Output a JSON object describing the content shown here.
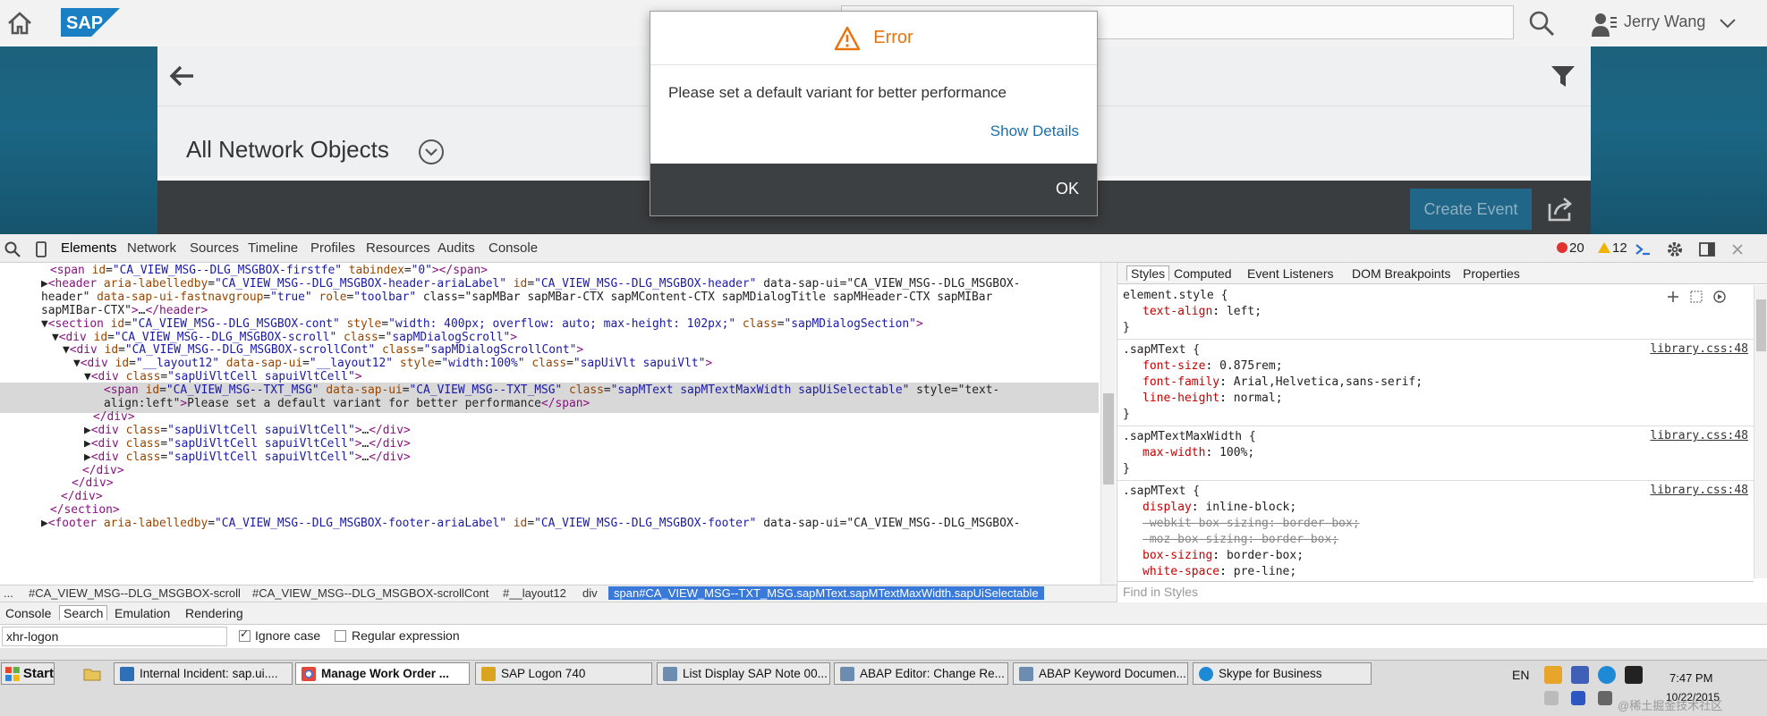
{
  "shell": {
    "user_name": "Jerry Wang"
  },
  "page": {
    "variant_title": "All Network Objects",
    "create_event_label": "Create Event"
  },
  "dialog": {
    "title": "Error",
    "message": "Please set a default variant for better performance",
    "show_details": "Show Details",
    "ok": "OK"
  },
  "devtools": {
    "tabs": [
      "Elements",
      "Network",
      "Sources",
      "Timeline",
      "Profiles",
      "Resources",
      "Audits",
      "Console"
    ],
    "error_count": "20",
    "warning_count": "12",
    "breadcrumbs": [
      "...",
      "#CA_VIEW_MSG--DLG_MSGBOX-scroll",
      "#CA_VIEW_MSG--DLG_MSGBOX-scrollCont",
      "#__layout12",
      "div",
      "span#CA_VIEW_MSG--TXT_MSG.sapMText.sapMTextMaxWidth.sapUiSelectable"
    ],
    "styles_tabs": [
      "Styles",
      "Computed",
      "Event Listeners",
      "DOM Breakpoints",
      "Properties"
    ],
    "find_placeholder": "Find in Styles",
    "rules": [
      {
        "selector": "element.style {",
        "source": "",
        "decls": [
          {
            "p": "text-align",
            "v": "left;"
          }
        ]
      },
      {
        "selector": ".sapMText {",
        "source": "library.css:48",
        "decls": [
          {
            "p": "font-size",
            "v": "0.875rem;"
          },
          {
            "p": "font-family",
            "v": "Arial,Helvetica,sans-serif;"
          },
          {
            "p": "line-height",
            "v": "normal;"
          }
        ]
      },
      {
        "selector": ".sapMTextMaxWidth {",
        "source": "library.css:48",
        "decls": [
          {
            "p": "max-width",
            "v": "100%;"
          }
        ]
      },
      {
        "selector": ".sapMText {",
        "source": "library.css:48",
        "decls": [
          {
            "p": "display",
            "v": "inline-block;"
          },
          {
            "p": "-webkit-box-sizing",
            "v": "border-box;",
            "struck": true
          },
          {
            "p": "-moz-box-sizing",
            "v": "border-box;",
            "struck": true
          },
          {
            "p": "box-sizing",
            "v": "border-box;"
          },
          {
            "p": "white-space",
            "v": "pre-line;"
          }
        ]
      }
    ],
    "drawer_tabs": [
      "Console",
      "Search",
      "Emulation",
      "Rendering"
    ],
    "search_value": "xhr-logon",
    "ignore_case_label": "Ignore case",
    "regex_label": "Regular expression",
    "dom_lines": [
      "<span id=\"CA_VIEW_MSG--DLG_MSGBOX-firstfe\" tabindex=\"0\"></span>",
      "▶<header aria-labelledby=\"CA_VIEW_MSG--DLG_MSGBOX-header-ariaLabel\" id=\"CA_VIEW_MSG--DLG_MSGBOX-header\" data-sap-ui=\"CA_VIEW_MSG--DLG_MSGBOX-",
      "header\" data-sap-ui-fastnavgroup=\"true\" role=\"toolbar\" class=\"sapMBar sapMBar-CTX sapMContent-CTX sapMDialogTitle sapMHeader-CTX sapMIBar",
      "sapMIBar-CTX\">…</header>",
      "▼<section id=\"CA_VIEW_MSG--DLG_MSGBOX-cont\" style=\"width: 400px; overflow: auto; max-height: 102px;\" class=\"sapMDialogSection\">",
      "▼<div id=\"CA_VIEW_MSG--DLG_MSGBOX-scroll\" class=\"sapMDialogScroll\">",
      "▼<div id=\"CA_VIEW_MSG--DLG_MSGBOX-scrollCont\" class=\"sapMDialogScrollCont\">",
      "▼<div id=\"__layout12\" data-sap-ui=\"__layout12\" style=\"width:100%\" class=\"sapUiVlt sapuiVlt\">",
      "▼<div class=\"sapUiVltCell sapuiVltCell\">",
      "<span id=\"CA_VIEW_MSG--TXT_MSG\" data-sap-ui=\"CA_VIEW_MSG--TXT_MSG\" class=\"sapMText sapMTextMaxWidth sapUiSelectable\" style=\"text-",
      "align:left\">Please set a default variant for better performance</span>",
      "</div>",
      "▶<div class=\"sapUiVltCell sapuiVltCell\">…</div>",
      "▶<div class=\"sapUiVltCell sapuiVltCell\">…</div>",
      "▶<div class=\"sapUiVltCell sapuiVltCell\">…</div>",
      "</div>",
      "</div>",
      "</div>",
      "</section>",
      "▶<footer aria-labelledby=\"CA_VIEW_MSG--DLG_MSGBOX-footer-ariaLabel\" id=\"CA_VIEW_MSG--DLG_MSGBOX-footer\" data-sap-ui=\"CA_VIEW_MSG--DLG_MSGBOX-"
    ]
  },
  "taskbar": {
    "start_label": "Start",
    "tasks": [
      "Internal Incident: sap.ui....",
      "Manage Work Order ...",
      "SAP Logon 740",
      "List Display SAP Note 00...",
      "ABAP Editor: Change Re...",
      "ABAP Keyword Documen...",
      "Skype for Business"
    ],
    "language": "EN",
    "time": "7:47 PM",
    "date": "10/22/2015",
    "watermark": "@稀土掘金技术社区"
  },
  "colors": {
    "accent_error": "#e9730c",
    "link": "#1a70a8",
    "breadcrumb_selected": "#3879d9"
  }
}
